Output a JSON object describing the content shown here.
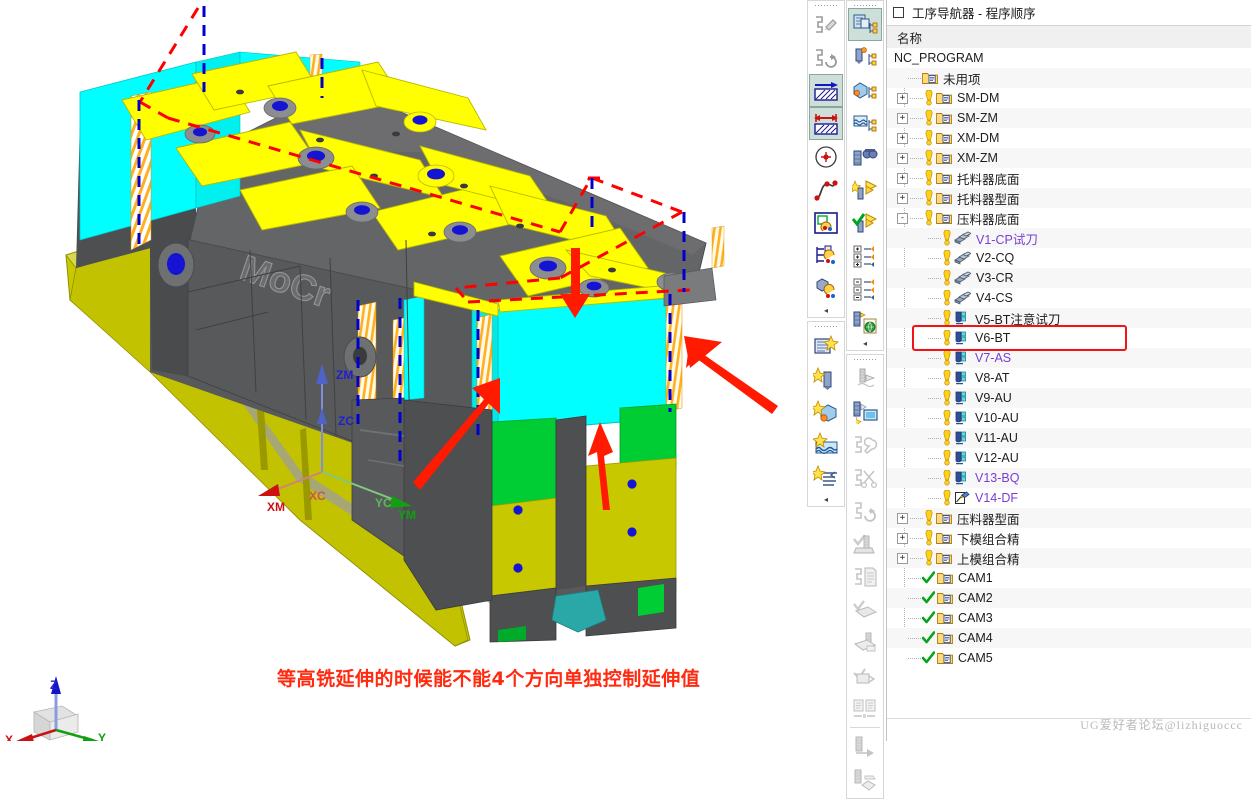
{
  "viewport": {
    "annotation_text": "等高铣延伸的时候能不能4个方向单独控制延伸值",
    "annotation_color": "#ff2a10",
    "part_engraving": "MoCr",
    "csys_labels": [
      {
        "name": "ZM",
        "color": "#2020d0"
      },
      {
        "name": "ZC",
        "color": "#2020d0"
      },
      {
        "name": "XM",
        "color": "#cc1111"
      },
      {
        "name": "XC",
        "color": "#cc1111"
      },
      {
        "name": "YM",
        "color": "#11a011"
      },
      {
        "name": "YC",
        "color": "#11a011"
      }
    ],
    "triad_labels": [
      {
        "name": "Z",
        "color": "#2020d0"
      },
      {
        "name": "X",
        "color": "#cc1111"
      },
      {
        "name": "Y",
        "color": "#11a011"
      }
    ],
    "model_colors": {
      "body_gray": "#58595b",
      "plate_yellow": "#ffff00",
      "surface_cyan": "#00ffff",
      "base_olive": "#c8c800",
      "accent_green": "#00cc33",
      "hole_blue": "#1414d2",
      "teal": "#2aa8a8",
      "dashed_red": "#ff0000",
      "dashed_blue": "#0000cc"
    }
  },
  "toolbars": {
    "column_a": [
      {
        "name": "create-operation-icon",
        "selected": false
      },
      {
        "name": "generate-toolpath-icon",
        "selected": false
      },
      {
        "name": "transform-toolpath-icon",
        "selected": true
      },
      {
        "name": "resize-toolpath-icon",
        "selected": true
      },
      {
        "name": "circle-target-icon",
        "selected": false
      },
      {
        "name": "spline-path-icon",
        "selected": false
      },
      {
        "name": "display-geometry-icon",
        "selected": false
      },
      {
        "name": "tree-display-icon",
        "selected": false
      },
      {
        "name": "machine-display-icon",
        "selected": false
      },
      {
        "name": "create-program-icon",
        "selected": false
      },
      {
        "name": "create-tool-icon",
        "selected": false
      },
      {
        "name": "create-geometry-icon",
        "selected": false
      },
      {
        "name": "create-method-icon",
        "selected": false
      },
      {
        "name": "create-operation2-icon",
        "selected": false
      }
    ],
    "column_b": [
      {
        "name": "program-order-view-icon",
        "selected": true
      },
      {
        "name": "machine-tool-view-icon",
        "selected": false
      },
      {
        "name": "geometry-view-icon",
        "selected": false
      },
      {
        "name": "machining-method-view-icon",
        "selected": false
      },
      {
        "name": "inspect-toolpath-icon",
        "selected": false
      },
      {
        "name": "generate-icon",
        "selected": false
      },
      {
        "name": "verify-icon",
        "selected": false
      },
      {
        "name": "expand-all-icon",
        "selected": false
      },
      {
        "name": "collapse-all-icon",
        "selected": false
      },
      {
        "name": "output-cls-icon",
        "selected": false
      },
      {
        "name": "toolpath-list-icon",
        "selected": false
      },
      {
        "name": "simulate-icon",
        "selected": false
      },
      {
        "name": "tool-setup-icon",
        "selected": false
      },
      {
        "name": "cut-toolpath-icon",
        "selected": false
      },
      {
        "name": "undo-operation-icon",
        "selected": false
      },
      {
        "name": "approve-toolpath-icon",
        "selected": false
      },
      {
        "name": "shop-documentation-icon",
        "selected": false
      },
      {
        "name": "postprocess-icon",
        "selected": false
      },
      {
        "name": "list-output-icon",
        "selected": false
      },
      {
        "name": "machine-code-icon",
        "selected": false
      },
      {
        "name": "compare-icon",
        "selected": false
      },
      {
        "name": "transfer-icon",
        "selected": false
      },
      {
        "name": "export-icon",
        "selected": false
      }
    ]
  },
  "navigator": {
    "title": "工序导航器 - 程序顺序",
    "column_header": "名称",
    "watermark": "UG爱好者论坛@lizhiguoccc",
    "highlight_row_name": "V6-BT",
    "highlight_color": "#f21414",
    "rows": [
      {
        "label": "NC_PROGRAM",
        "depth": 0,
        "expander": "",
        "icon": "none",
        "purple": false
      },
      {
        "label": "未用项",
        "depth": 1,
        "expander": "",
        "icon": "folder",
        "purple": false,
        "warn": false
      },
      {
        "label": "SM-DM",
        "depth": 1,
        "expander": "+",
        "icon": "folder",
        "purple": false,
        "warn": true
      },
      {
        "label": "SM-ZM",
        "depth": 1,
        "expander": "+",
        "icon": "folder",
        "purple": false,
        "warn": true
      },
      {
        "label": "XM-DM",
        "depth": 1,
        "expander": "+",
        "icon": "folder",
        "purple": false,
        "warn": true
      },
      {
        "label": "XM-ZM",
        "depth": 1,
        "expander": "+",
        "icon": "folder",
        "purple": false,
        "warn": true
      },
      {
        "label": "托料器底面",
        "depth": 1,
        "expander": "+",
        "icon": "folder",
        "purple": false,
        "warn": true
      },
      {
        "label": "托料器型面",
        "depth": 1,
        "expander": "+",
        "icon": "folder",
        "purple": false,
        "warn": true
      },
      {
        "label": "压料器底面",
        "depth": 1,
        "expander": "-",
        "icon": "folder",
        "purple": false,
        "warn": true
      },
      {
        "label": "V1-CP试刀",
        "depth": 2,
        "expander": "",
        "icon": "cavity",
        "purple": true,
        "warn": true
      },
      {
        "label": "V2-CQ",
        "depth": 2,
        "expander": "",
        "icon": "cavity",
        "purple": false,
        "warn": true
      },
      {
        "label": "V3-CR",
        "depth": 2,
        "expander": "",
        "icon": "cavity",
        "purple": false,
        "warn": true
      },
      {
        "label": "V4-CS",
        "depth": 2,
        "expander": "",
        "icon": "cavity",
        "purple": false,
        "warn": true
      },
      {
        "label": "V5-BT注意试刀",
        "depth": 2,
        "expander": "",
        "icon": "zlevel",
        "purple": false,
        "warn": true
      },
      {
        "label": "V6-BT",
        "depth": 2,
        "expander": "",
        "icon": "zlevel",
        "purple": false,
        "warn": true
      },
      {
        "label": "V7-AS",
        "depth": 2,
        "expander": "",
        "icon": "zlevel",
        "purple": true,
        "warn": true
      },
      {
        "label": "V8-AT",
        "depth": 2,
        "expander": "",
        "icon": "zlevel",
        "purple": false,
        "warn": true
      },
      {
        "label": "V9-AU",
        "depth": 2,
        "expander": "",
        "icon": "zlevel",
        "purple": false,
        "warn": true
      },
      {
        "label": "V10-AU",
        "depth": 2,
        "expander": "",
        "icon": "zlevel",
        "purple": false,
        "warn": true
      },
      {
        "label": "V11-AU",
        "depth": 2,
        "expander": "",
        "icon": "zlevel",
        "purple": false,
        "warn": true
      },
      {
        "label": "V12-AU",
        "depth": 2,
        "expander": "",
        "icon": "zlevel",
        "purple": false,
        "warn": true
      },
      {
        "label": "V13-BQ",
        "depth": 2,
        "expander": "",
        "icon": "zlevel",
        "purple": true,
        "warn": true
      },
      {
        "label": "V14-DF",
        "depth": 2,
        "expander": "",
        "icon": "flowcut",
        "purple": true,
        "warn": true
      },
      {
        "label": "压料器型面",
        "depth": 1,
        "expander": "+",
        "icon": "folder",
        "purple": false,
        "warn": true
      },
      {
        "label": "下模组合精",
        "depth": 1,
        "expander": "+",
        "icon": "folder",
        "purple": false,
        "warn": true
      },
      {
        "label": "上模组合精",
        "depth": 1,
        "expander": "+",
        "icon": "folder",
        "purple": false,
        "warn": true
      },
      {
        "label": "CAM1",
        "depth": 1,
        "expander": "",
        "icon": "folder",
        "purple": false,
        "check": true
      },
      {
        "label": "CAM2",
        "depth": 1,
        "expander": "",
        "icon": "folder",
        "purple": false,
        "check": true
      },
      {
        "label": "CAM3",
        "depth": 1,
        "expander": "",
        "icon": "folder",
        "purple": false,
        "check": true
      },
      {
        "label": "CAM4",
        "depth": 1,
        "expander": "",
        "icon": "folder",
        "purple": false,
        "check": true
      },
      {
        "label": "CAM5",
        "depth": 1,
        "expander": "",
        "icon": "folder",
        "purple": false,
        "check": true
      }
    ]
  }
}
